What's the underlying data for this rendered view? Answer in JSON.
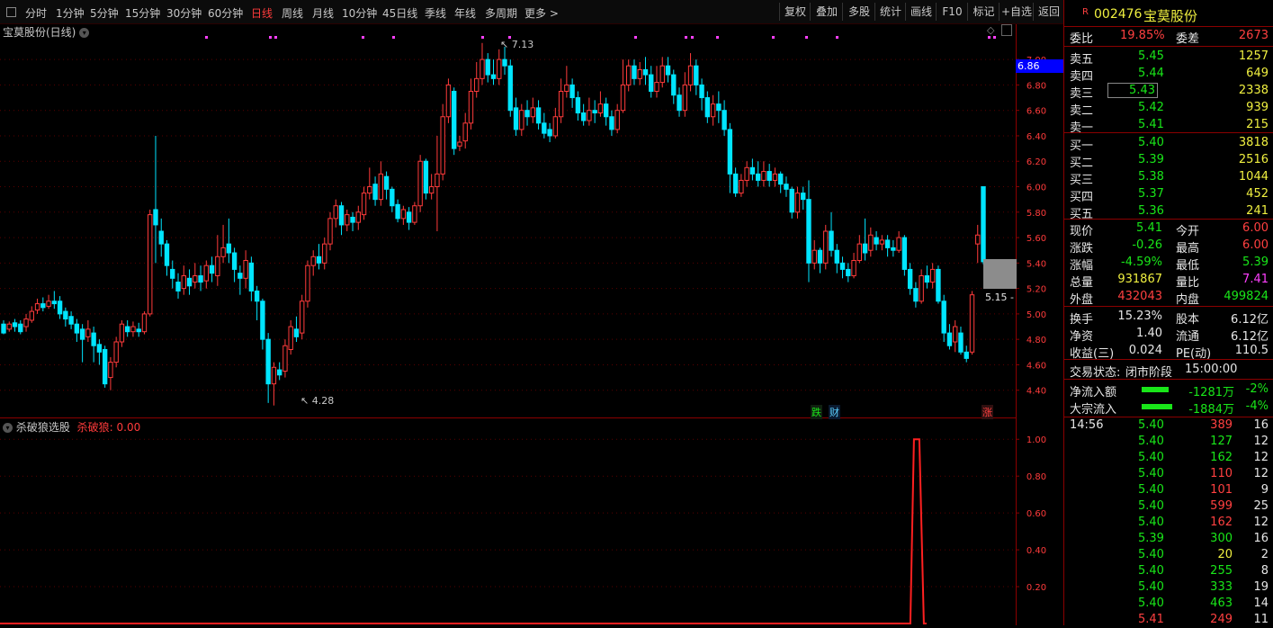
{
  "toolbar": {
    "periods": [
      "分时",
      "1分钟",
      "5分钟",
      "15分钟",
      "30分钟",
      "60分钟",
      "日线",
      "周线",
      "月线",
      "10分钟",
      "45日线",
      "季线",
      "年线",
      "多周期",
      "更多 >"
    ],
    "active_period": "日线",
    "right_buttons": [
      "复权",
      "叠加",
      "多股",
      "统计",
      "画线",
      "F10",
      "标记",
      "+自选",
      "返回"
    ]
  },
  "main_chart": {
    "title": "宝莫股份(日线)",
    "price_axis": [
      "7.00",
      "6.80",
      "6.60",
      "6.40",
      "6.20",
      "6.00",
      "5.80",
      "5.60",
      "5.40",
      "5.20",
      "5.00",
      "4.80",
      "4.60",
      "4.40"
    ],
    "high_label": "7.13",
    "low_label": "4.28",
    "current_tag": "6.86",
    "cursor_tag": "5.15 -",
    "markers": [
      "跌",
      "财",
      "涨"
    ]
  },
  "indicator": {
    "name": "杀破狼选股",
    "series_label": "杀破狼: 0.00",
    "axis": [
      "1.00",
      "0.80",
      "0.60",
      "0.40",
      "0.20"
    ]
  },
  "colors": {
    "up": "#ff3b3b",
    "down": "#00e5ff",
    "border": "#8b0000",
    "ind_line": "#ff2020"
  },
  "quote": {
    "badge": "R",
    "code": "002476",
    "name": "宝莫股份",
    "weibi_label": "委比",
    "weibi": "19.85%",
    "weicha_label": "委差",
    "weicha": "2673",
    "sell": [
      {
        "label": "卖五",
        "price": "5.45",
        "vol": "1257"
      },
      {
        "label": "卖四",
        "price": "5.44",
        "vol": "649"
      },
      {
        "label": "卖三",
        "price": "5.43",
        "vol": "2338"
      },
      {
        "label": "卖二",
        "price": "5.42",
        "vol": "939"
      },
      {
        "label": "卖一",
        "price": "5.41",
        "vol": "215"
      }
    ],
    "buy": [
      {
        "label": "买一",
        "price": "5.40",
        "vol": "3818"
      },
      {
        "label": "买二",
        "price": "5.39",
        "vol": "2516"
      },
      {
        "label": "买三",
        "price": "5.38",
        "vol": "1044"
      },
      {
        "label": "买四",
        "price": "5.37",
        "vol": "452"
      },
      {
        "label": "买五",
        "price": "5.36",
        "vol": "241"
      }
    ],
    "stats": [
      {
        "l1": "现价",
        "v1": "5.41",
        "c1": "green",
        "l2": "今开",
        "v2": "6.00",
        "c2": "red"
      },
      {
        "l1": "涨跌",
        "v1": "-0.26",
        "c1": "green",
        "l2": "最高",
        "v2": "6.00",
        "c2": "red"
      },
      {
        "l1": "涨幅",
        "v1": "-4.59%",
        "c1": "green",
        "l2": "最低",
        "v2": "5.39",
        "c2": "green"
      },
      {
        "l1": "总量",
        "v1": "931867",
        "c1": "yellow",
        "l2": "量比",
        "v2": "7.41",
        "c2": "magenta"
      },
      {
        "l1": "外盘",
        "v1": "432043",
        "c1": "red",
        "l2": "内盘",
        "v2": "499824",
        "c2": "green"
      }
    ],
    "fundamentals": [
      {
        "l1": "换手",
        "v1": "15.23%",
        "l2": "股本",
        "v2": "6.12亿"
      },
      {
        "l1": "净资",
        "v1": "1.40",
        "l2": "流通",
        "v2": "6.12亿"
      },
      {
        "l1": "收益(三)",
        "v1": "0.024",
        "l2": "PE(动)",
        "v2": "110.5"
      }
    ],
    "trade_status_label": "交易状态:",
    "trade_status": "闭市阶段",
    "trade_time": "15:00:00",
    "flows": [
      {
        "label": "净流入额",
        "value": "-1281万",
        "pct": "-2%"
      },
      {
        "label": "大宗流入",
        "value": "-1884万",
        "pct": "-4%"
      }
    ],
    "ticks": [
      {
        "time": "14:56",
        "price": "5.40",
        "pc": "green",
        "vol": "389",
        "vc": "red",
        "n": "16"
      },
      {
        "time": "",
        "price": "5.40",
        "pc": "green",
        "vol": "127",
        "vc": "green",
        "n": "12"
      },
      {
        "time": "",
        "price": "5.40",
        "pc": "green",
        "vol": "162",
        "vc": "green",
        "n": "12"
      },
      {
        "time": "",
        "price": "5.40",
        "pc": "green",
        "vol": "110",
        "vc": "red",
        "n": "12"
      },
      {
        "time": "",
        "price": "5.40",
        "pc": "green",
        "vol": "101",
        "vc": "red",
        "n": "9"
      },
      {
        "time": "",
        "price": "5.40",
        "pc": "green",
        "vol": "599",
        "vc": "red",
        "n": "25"
      },
      {
        "time": "",
        "price": "5.40",
        "pc": "green",
        "vol": "162",
        "vc": "red",
        "n": "12"
      },
      {
        "time": "",
        "price": "5.39",
        "pc": "green",
        "vol": "300",
        "vc": "green",
        "n": "16"
      },
      {
        "time": "",
        "price": "5.40",
        "pc": "green",
        "vol": "20",
        "vc": "yellow",
        "n": "2"
      },
      {
        "time": "",
        "price": "5.40",
        "pc": "green",
        "vol": "255",
        "vc": "green",
        "n": "8"
      },
      {
        "time": "",
        "price": "5.40",
        "pc": "green",
        "vol": "333",
        "vc": "green",
        "n": "19"
      },
      {
        "time": "",
        "price": "5.40",
        "pc": "green",
        "vol": "463",
        "vc": "green",
        "n": "14"
      },
      {
        "time": "",
        "price": "5.41",
        "pc": "red",
        "vol": "249",
        "vc": "red",
        "n": "11"
      }
    ]
  },
  "chart_data": {
    "type": "candlestick",
    "y_range": [
      4.2,
      7.1
    ],
    "indicator_range": [
      0,
      1.05
    ],
    "candles": [
      [
        4.92,
        4.85,
        4.95,
        4.84
      ],
      [
        4.88,
        4.92,
        4.94,
        4.86
      ],
      [
        4.93,
        4.9,
        4.96,
        4.86
      ],
      [
        4.92,
        4.86,
        4.95,
        4.84
      ],
      [
        4.9,
        4.96,
        5.0,
        4.86
      ],
      [
        4.95,
        5.02,
        5.06,
        4.93
      ],
      [
        5.03,
        5.08,
        5.12,
        5.0
      ],
      [
        5.08,
        5.05,
        5.13,
        5.02
      ],
      [
        5.06,
        5.1,
        5.15,
        5.04
      ],
      [
        5.1,
        5.08,
        5.18,
        5.04
      ],
      [
        5.1,
        5.0,
        5.14,
        4.96
      ],
      [
        5.02,
        4.96,
        5.05,
        4.9
      ],
      [
        4.98,
        4.92,
        5.02,
        4.88
      ],
      [
        4.92,
        4.85,
        4.96,
        4.78
      ],
      [
        4.88,
        4.8,
        4.92,
        4.62
      ],
      [
        4.82,
        4.88,
        4.95,
        4.78
      ],
      [
        4.85,
        4.75,
        4.9,
        4.62
      ],
      [
        4.76,
        4.7,
        4.8,
        4.6
      ],
      [
        4.72,
        4.45,
        4.75,
        4.42
      ],
      [
        4.5,
        4.62,
        4.66,
        4.4
      ],
      [
        4.62,
        4.78,
        4.82,
        4.58
      ],
      [
        4.78,
        4.92,
        4.95,
        4.74
      ],
      [
        4.9,
        4.86,
        4.95,
        4.82
      ],
      [
        4.86,
        4.9,
        4.94,
        4.82
      ],
      [
        4.88,
        4.86,
        4.93,
        4.82
      ],
      [
        4.86,
        5.0,
        5.02,
        4.84
      ],
      [
        5.0,
        5.78,
        5.82,
        4.98
      ],
      [
        5.82,
        5.7,
        6.4,
        5.4
      ],
      [
        5.65,
        5.55,
        5.75,
        5.45
      ],
      [
        5.55,
        5.38,
        5.58,
        5.3
      ],
      [
        5.35,
        5.28,
        5.42,
        5.2
      ],
      [
        5.25,
        5.18,
        5.32,
        5.12
      ],
      [
        5.2,
        5.3,
        5.38,
        5.15
      ],
      [
        5.28,
        5.22,
        5.35,
        5.15
      ],
      [
        5.25,
        5.3,
        5.4,
        5.2
      ],
      [
        5.3,
        5.25,
        5.38,
        5.18
      ],
      [
        5.26,
        5.38,
        5.42,
        5.2
      ],
      [
        5.38,
        5.32,
        5.45,
        5.25
      ],
      [
        5.3,
        5.45,
        5.62,
        5.22
      ],
      [
        5.45,
        5.52,
        5.7,
        5.4
      ],
      [
        5.55,
        5.48,
        5.75,
        5.4
      ],
      [
        5.48,
        5.35,
        5.52,
        5.25
      ],
      [
        5.32,
        5.28,
        5.38,
        5.15
      ],
      [
        5.28,
        5.42,
        5.5,
        5.2
      ],
      [
        5.4,
        5.18,
        5.45,
        5.1
      ],
      [
        5.18,
        5.1,
        5.22,
        4.95
      ],
      [
        5.1,
        4.8,
        5.12,
        4.72
      ],
      [
        4.8,
        4.45,
        4.85,
        4.3
      ],
      [
        4.45,
        4.58,
        4.62,
        4.28
      ],
      [
        4.56,
        4.52,
        4.62,
        4.48
      ],
      [
        4.55,
        4.75,
        4.8,
        4.5
      ],
      [
        4.72,
        4.9,
        4.95,
        4.68
      ],
      [
        4.88,
        4.82,
        4.98,
        4.78
      ],
      [
        4.85,
        5.1,
        5.15,
        4.8
      ],
      [
        5.1,
        5.38,
        5.42,
        5.05
      ],
      [
        5.38,
        5.45,
        5.5,
        5.3
      ],
      [
        5.45,
        5.4,
        5.55,
        5.35
      ],
      [
        5.4,
        5.55,
        5.6,
        5.35
      ],
      [
        5.55,
        5.75,
        5.8,
        5.5
      ],
      [
        5.75,
        5.85,
        5.9,
        5.68
      ],
      [
        5.85,
        5.7,
        5.88,
        5.62
      ],
      [
        5.7,
        5.78,
        5.82,
        5.65
      ],
      [
        5.76,
        5.72,
        5.8,
        5.65
      ],
      [
        5.72,
        5.8,
        5.85,
        5.66
      ],
      [
        5.78,
        5.95,
        6.0,
        5.74
      ],
      [
        5.95,
        6.0,
        6.15,
        5.9
      ],
      [
        6.02,
        5.9,
        6.08,
        5.85
      ],
      [
        5.9,
        6.1,
        6.2,
        5.85
      ],
      [
        6.08,
        5.98,
        6.12,
        5.9
      ],
      [
        5.98,
        5.85,
        6.0,
        5.8
      ],
      [
        5.86,
        5.75,
        5.9,
        5.72
      ],
      [
        5.75,
        5.82,
        5.85,
        5.7
      ],
      [
        5.8,
        5.72,
        5.84,
        5.66
      ],
      [
        5.72,
        5.85,
        5.88,
        5.7
      ],
      [
        5.85,
        6.2,
        6.25,
        5.8
      ],
      [
        6.2,
        5.95,
        6.22,
        5.9
      ],
      [
        5.95,
        6.0,
        6.1,
        5.9
      ],
      [
        6.0,
        6.1,
        6.4,
        5.65
      ],
      [
        6.1,
        6.55,
        6.65,
        6.05
      ],
      [
        6.55,
        6.8,
        6.85,
        6.5
      ],
      [
        6.75,
        6.3,
        6.78,
        6.25
      ],
      [
        6.32,
        6.35,
        6.4,
        6.28
      ],
      [
        6.36,
        6.5,
        6.58,
        6.3
      ],
      [
        6.5,
        6.75,
        6.85,
        6.45
      ],
      [
        6.75,
        6.85,
        6.98,
        6.7
      ],
      [
        6.85,
        7.0,
        7.13,
        6.8
      ],
      [
        7.0,
        6.88,
        7.05,
        6.82
      ],
      [
        6.88,
        6.85,
        7.0,
        6.8
      ],
      [
        6.85,
        7.0,
        7.08,
        6.8
      ],
      [
        7.0,
        6.95,
        7.1,
        6.88
      ],
      [
        6.95,
        6.6,
        7.0,
        6.55
      ],
      [
        6.62,
        6.45,
        6.7,
        6.4
      ],
      [
        6.45,
        6.6,
        6.65,
        6.4
      ],
      [
        6.6,
        6.55,
        6.68,
        6.48
      ],
      [
        6.55,
        6.62,
        6.7,
        6.5
      ],
      [
        6.62,
        6.5,
        6.68,
        6.45
      ],
      [
        6.5,
        6.42,
        6.58,
        6.38
      ],
      [
        6.45,
        6.4,
        6.5,
        6.35
      ],
      [
        6.4,
        6.55,
        6.62,
        6.38
      ],
      [
        6.55,
        6.75,
        6.85,
        6.5
      ],
      [
        6.75,
        6.8,
        6.95,
        6.7
      ],
      [
        6.8,
        6.7,
        6.85,
        6.62
      ],
      [
        6.7,
        6.58,
        6.75,
        6.52
      ],
      [
        6.58,
        6.52,
        6.65,
        6.48
      ],
      [
        6.52,
        6.6,
        6.7,
        6.48
      ],
      [
        6.6,
        6.58,
        6.68,
        6.5
      ],
      [
        6.58,
        6.65,
        6.75,
        6.55
      ],
      [
        6.65,
        6.55,
        6.7,
        6.48
      ],
      [
        6.55,
        6.45,
        6.6,
        6.4
      ],
      [
        6.45,
        6.6,
        6.65,
        6.42
      ],
      [
        6.6,
        6.8,
        7.0,
        6.58
      ],
      [
        6.8,
        6.95,
        7.0,
        6.75
      ],
      [
        6.95,
        6.85,
        7.0,
        6.8
      ],
      [
        6.85,
        6.92,
        6.98,
        6.8
      ],
      [
        6.92,
        6.88,
        7.02,
        6.8
      ],
      [
        6.88,
        6.75,
        6.95,
        6.7
      ],
      [
        6.75,
        6.82,
        6.95,
        6.7
      ],
      [
        6.82,
        6.95,
        7.02,
        6.78
      ],
      [
        6.95,
        6.88,
        7.02,
        6.82
      ],
      [
        6.88,
        6.72,
        6.92,
        6.65
      ],
      [
        6.72,
        6.6,
        6.78,
        6.55
      ],
      [
        6.6,
        6.8,
        6.9,
        6.55
      ],
      [
        6.8,
        6.95,
        7.05,
        6.75
      ],
      [
        6.95,
        6.8,
        7.0,
        6.72
      ],
      [
        6.8,
        6.7,
        6.85,
        6.6
      ],
      [
        6.7,
        6.55,
        6.75,
        6.5
      ],
      [
        6.55,
        6.65,
        6.72,
        6.48
      ],
      [
        6.65,
        6.6,
        6.75,
        6.5
      ],
      [
        6.6,
        6.45,
        6.68,
        6.4
      ],
      [
        6.45,
        6.1,
        6.5,
        5.95
      ],
      [
        6.1,
        5.95,
        6.15,
        5.92
      ],
      [
        5.95,
        6.05,
        6.1,
        5.92
      ],
      [
        6.05,
        6.15,
        6.2,
        6.0
      ],
      [
        6.15,
        6.1,
        6.22,
        6.05
      ],
      [
        6.1,
        6.05,
        6.2,
        6.0
      ],
      [
        6.05,
        6.12,
        6.2,
        6.0
      ],
      [
        6.12,
        6.05,
        6.18,
        6.0
      ],
      [
        6.05,
        6.1,
        6.15,
        6.0
      ],
      [
        6.1,
        6.02,
        6.12,
        5.95
      ],
      [
        6.02,
        5.98,
        6.08,
        5.92
      ],
      [
        5.98,
        5.8,
        6.0,
        5.75
      ],
      [
        5.8,
        5.95,
        6.0,
        5.75
      ],
      [
        5.95,
        5.9,
        6.0,
        5.82
      ],
      [
        5.9,
        5.4,
        6.05,
        5.25
      ],
      [
        5.4,
        5.5,
        5.58,
        5.35
      ],
      [
        5.5,
        5.4,
        5.52,
        5.32
      ],
      [
        5.4,
        5.65,
        5.7,
        5.35
      ],
      [
        5.65,
        5.5,
        5.8,
        5.45
      ],
      [
        5.5,
        5.4,
        5.55,
        5.32
      ],
      [
        5.4,
        5.35,
        5.45,
        5.28
      ],
      [
        5.35,
        5.3,
        5.4,
        5.25
      ],
      [
        5.3,
        5.42,
        5.48,
        5.28
      ],
      [
        5.42,
        5.55,
        5.62,
        5.4
      ],
      [
        5.55,
        5.48,
        5.75,
        5.42
      ],
      [
        5.5,
        5.62,
        5.68,
        5.45
      ],
      [
        5.6,
        5.55,
        5.65,
        5.5
      ],
      [
        5.55,
        5.58,
        5.62,
        5.5
      ],
      [
        5.58,
        5.52,
        5.62,
        5.45
      ],
      [
        5.52,
        5.5,
        5.58,
        5.45
      ],
      [
        5.5,
        5.6,
        5.65,
        5.48
      ],
      [
        5.6,
        5.35,
        5.62,
        5.3
      ],
      [
        5.35,
        5.2,
        5.4,
        5.15
      ],
      [
        5.2,
        5.1,
        5.25,
        5.05
      ],
      [
        5.1,
        5.3,
        5.35,
        5.08
      ],
      [
        5.3,
        5.25,
        5.38,
        5.2
      ],
      [
        5.25,
        5.35,
        5.4,
        5.2
      ],
      [
        5.35,
        5.1,
        5.38,
        5.08
      ],
      [
        5.1,
        4.85,
        5.15,
        4.78
      ],
      [
        4.85,
        4.75,
        4.92,
        4.72
      ],
      [
        4.78,
        4.9,
        4.95,
        4.7
      ],
      [
        4.85,
        4.7,
        4.9,
        4.68
      ],
      [
        4.7,
        4.65,
        4.75,
        4.62
      ],
      [
        4.7,
        5.15,
        5.18,
        4.68
      ],
      [
        5.55,
        5.62,
        5.7,
        5.4
      ],
      [
        6.0,
        5.41,
        6.0,
        5.39
      ]
    ],
    "indicator": {
      "spike_index": 162,
      "spike_value": 1.0
    }
  }
}
